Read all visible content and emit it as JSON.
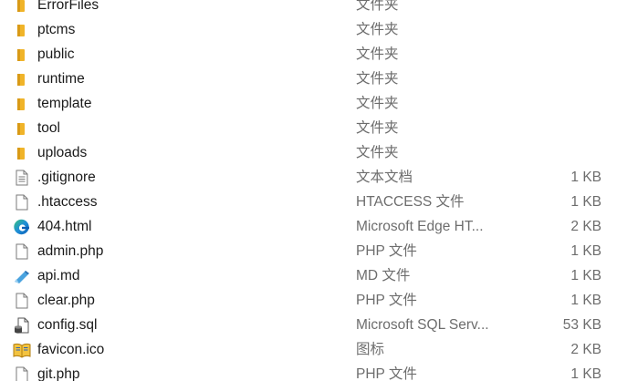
{
  "files": [
    {
      "name": "ErrorFiles",
      "type": "文件夹",
      "size": "",
      "icon": "folder-icon"
    },
    {
      "name": "ptcms",
      "type": "文件夹",
      "size": "",
      "icon": "folder-icon"
    },
    {
      "name": "public",
      "type": "文件夹",
      "size": "",
      "icon": "folder-icon"
    },
    {
      "name": "runtime",
      "type": "文件夹",
      "size": "",
      "icon": "folder-icon"
    },
    {
      "name": "template",
      "type": "文件夹",
      "size": "",
      "icon": "folder-icon"
    },
    {
      "name": "tool",
      "type": "文件夹",
      "size": "",
      "icon": "folder-icon"
    },
    {
      "name": "uploads",
      "type": "文件夹",
      "size": "",
      "icon": "folder-icon"
    },
    {
      "name": ".gitignore",
      "type": "文本文档",
      "size": "1 KB",
      "icon": "text-document-icon"
    },
    {
      "name": ".htaccess",
      "type": "HTACCESS 文件",
      "size": "1 KB",
      "icon": "blank-file-icon"
    },
    {
      "name": "404.html",
      "type": "Microsoft Edge HT...",
      "size": "2 KB",
      "icon": "edge-icon"
    },
    {
      "name": "admin.php",
      "type": "PHP 文件",
      "size": "1 KB",
      "icon": "blank-file-icon"
    },
    {
      "name": "api.md",
      "type": "MD 文件",
      "size": "1 KB",
      "icon": "markdown-file-icon"
    },
    {
      "name": "clear.php",
      "type": "PHP 文件",
      "size": "1 KB",
      "icon": "blank-file-icon"
    },
    {
      "name": "config.sql",
      "type": "Microsoft SQL Serv...",
      "size": "53 KB",
      "icon": "sql-file-icon"
    },
    {
      "name": "favicon.ico",
      "type": "图标",
      "size": "2 KB",
      "icon": "icon-file-icon"
    },
    {
      "name": "git.php",
      "type": "PHP 文件",
      "size": "1 KB",
      "icon": "blank-file-icon"
    }
  ]
}
